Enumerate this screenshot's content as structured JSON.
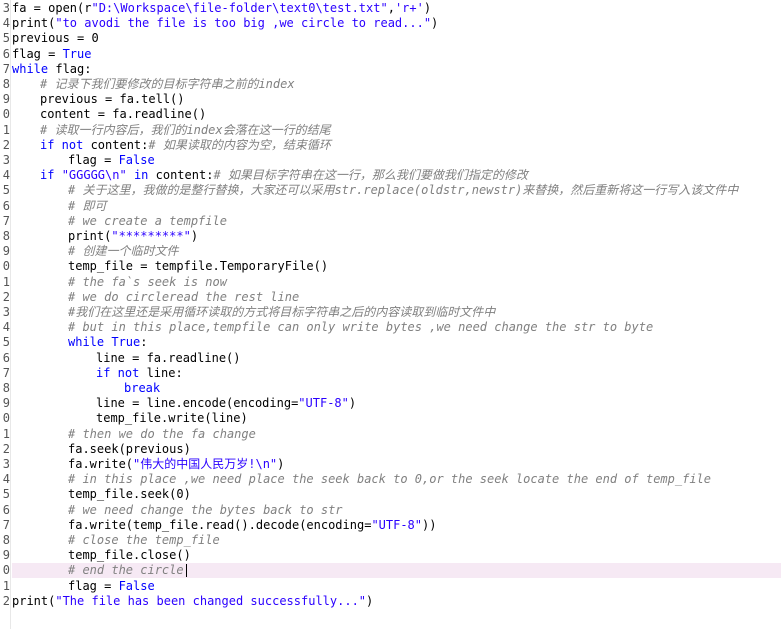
{
  "line_numbers": [
    "3",
    "4",
    "5",
    "6",
    "7",
    "8",
    "9",
    "0",
    "1",
    "2",
    "3",
    "4",
    "5",
    "6",
    "7",
    "8",
    "9",
    "0",
    "1",
    "2",
    "3",
    "4",
    "5",
    "6",
    "7",
    "8",
    "9",
    "0",
    "1",
    "2",
    "3",
    "4",
    "5",
    "6",
    "7",
    "8",
    "9",
    "0",
    "1",
    "2"
  ],
  "lines": [
    {
      "indent": 0,
      "tokens": [
        [
          "n",
          "fa = open(r"
        ],
        [
          "s",
          "\"D:\\Workspace\\file-folder\\text0\\test.txt\""
        ],
        [
          "n",
          ","
        ],
        [
          "s",
          "'r+'"
        ],
        [
          "n",
          ")"
        ]
      ]
    },
    {
      "indent": 0,
      "tokens": [
        [
          "n",
          "print("
        ],
        [
          "s",
          "\"to avodi the file is too big ,we circle to read...\""
        ],
        [
          "n",
          ")"
        ]
      ]
    },
    {
      "indent": 0,
      "tokens": [
        [
          "n",
          "previous = 0"
        ]
      ]
    },
    {
      "indent": 0,
      "tokens": [
        [
          "n",
          "flag = "
        ],
        [
          "k",
          "True"
        ]
      ]
    },
    {
      "indent": 0,
      "tokens": [
        [
          "k",
          "while"
        ],
        [
          "n",
          " flag:"
        ]
      ]
    },
    {
      "indent": 1,
      "tokens": [
        [
          "c",
          "# 记录下我们要修改的目标字符串之前的index"
        ]
      ]
    },
    {
      "indent": 1,
      "tokens": [
        [
          "n",
          "previous = fa.tell()"
        ]
      ]
    },
    {
      "indent": 1,
      "tokens": [
        [
          "n",
          "content = fa.readline()"
        ]
      ]
    },
    {
      "indent": 1,
      "tokens": [
        [
          "c",
          "# 读取一行内容后，我们的index会落在这一行的结尾"
        ]
      ]
    },
    {
      "indent": 1,
      "tokens": [
        [
          "k",
          "if not"
        ],
        [
          "n",
          " content:"
        ],
        [
          "c",
          "# 如果读取的内容为空，结束循环"
        ]
      ]
    },
    {
      "indent": 2,
      "tokens": [
        [
          "n",
          "flag = "
        ],
        [
          "k",
          "False"
        ]
      ]
    },
    {
      "indent": 1,
      "tokens": [
        [
          "k",
          "if"
        ],
        [
          "n",
          " "
        ],
        [
          "s",
          "\"GGGGG\\n\""
        ],
        [
          "n",
          " "
        ],
        [
          "k",
          "in"
        ],
        [
          "n",
          " content:"
        ],
        [
          "c",
          "# 如果目标字符串在这一行，那么我们要做我们指定的修改"
        ]
      ]
    },
    {
      "indent": 2,
      "tokens": [
        [
          "c",
          "# 关于这里，我做的是整行替换，大家还可以采用str.replace(oldstr,newstr)来替换，然后重新将这一行写入该文件中"
        ]
      ]
    },
    {
      "indent": 2,
      "tokens": [
        [
          "c",
          "# 即可"
        ]
      ]
    },
    {
      "indent": 2,
      "tokens": [
        [
          "c",
          "# we create a tempfile"
        ]
      ]
    },
    {
      "indent": 2,
      "tokens": [
        [
          "n",
          "print("
        ],
        [
          "s",
          "\"*********\""
        ],
        [
          "n",
          ")"
        ]
      ]
    },
    {
      "indent": 2,
      "tokens": [
        [
          "c",
          "# 创建一个临时文件"
        ]
      ]
    },
    {
      "indent": 2,
      "tokens": [
        [
          "n",
          "temp_file = tempfile.TemporaryFile()"
        ]
      ]
    },
    {
      "indent": 2,
      "tokens": [
        [
          "c",
          "# the fa`s seek is now"
        ]
      ]
    },
    {
      "indent": 2,
      "tokens": [
        [
          "c",
          "# we do circleread the rest line"
        ]
      ]
    },
    {
      "indent": 2,
      "tokens": [
        [
          "c",
          "#我们在这里还是采用循环读取的方式将目标字符串之后的内容读取到临时文件中"
        ]
      ]
    },
    {
      "indent": 2,
      "tokens": [
        [
          "c",
          "# but in this place,tempfile can only write bytes ,we need change the str to byte"
        ]
      ]
    },
    {
      "indent": 2,
      "tokens": [
        [
          "k",
          "while True"
        ],
        [
          "n",
          ":"
        ]
      ]
    },
    {
      "indent": 3,
      "tokens": [
        [
          "n",
          "line = fa.readline()"
        ]
      ]
    },
    {
      "indent": 3,
      "tokens": [
        [
          "k",
          "if not"
        ],
        [
          "n",
          " line:"
        ]
      ]
    },
    {
      "indent": 4,
      "tokens": [
        [
          "k",
          "break"
        ]
      ]
    },
    {
      "indent": 3,
      "tokens": [
        [
          "n",
          "line = line.encode(encoding="
        ],
        [
          "s",
          "\"UTF-8\""
        ],
        [
          "n",
          ")"
        ]
      ]
    },
    {
      "indent": 3,
      "tokens": [
        [
          "n",
          "temp_file.write(line)"
        ]
      ]
    },
    {
      "indent": 2,
      "tokens": [
        [
          "c",
          "# then we do the fa change"
        ]
      ]
    },
    {
      "indent": 2,
      "tokens": [
        [
          "n",
          "fa.seek(previous)"
        ]
      ]
    },
    {
      "indent": 2,
      "tokens": [
        [
          "n",
          "fa.write("
        ],
        [
          "s",
          "\"伟大的中国人民万岁!\\n\""
        ],
        [
          "n",
          ")"
        ]
      ]
    },
    {
      "indent": 2,
      "tokens": [
        [
          "c",
          "# in this place ,we need place the seek back to 0,or the seek locate the end of temp_file"
        ]
      ]
    },
    {
      "indent": 2,
      "tokens": [
        [
          "n",
          "temp_file.seek("
        ],
        [
          "num",
          "0"
        ],
        [
          "n",
          ")"
        ]
      ]
    },
    {
      "indent": 2,
      "tokens": [
        [
          "c",
          "# we need change the bytes back to str"
        ]
      ]
    },
    {
      "indent": 2,
      "tokens": [
        [
          "n",
          "fa.write(temp_file.read().decode(encoding="
        ],
        [
          "s",
          "\"UTF-8\""
        ],
        [
          "n",
          "))"
        ]
      ]
    },
    {
      "indent": 2,
      "tokens": [
        [
          "c",
          "# close the temp_file"
        ]
      ]
    },
    {
      "indent": 2,
      "tokens": [
        [
          "n",
          "temp_file.close()"
        ]
      ]
    },
    {
      "indent": 2,
      "tokens": [
        [
          "c",
          "# end the circle"
        ]
      ],
      "current": true
    },
    {
      "indent": 2,
      "tokens": [
        [
          "n",
          "flag = "
        ],
        [
          "k",
          "False"
        ]
      ]
    },
    {
      "indent": 0,
      "tokens": [
        [
          "n",
          "print("
        ],
        [
          "s",
          "\"The file has been changed successfully...\""
        ],
        [
          "n",
          ")"
        ]
      ]
    }
  ]
}
